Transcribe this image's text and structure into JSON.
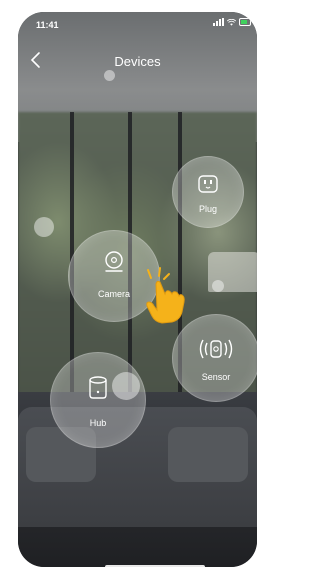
{
  "status_bar": {
    "time": "11:41",
    "battery_color": "#41d15e"
  },
  "nav": {
    "back_icon": "chevron-left-icon",
    "title": "Devices"
  },
  "devices": [
    {
      "label": "Plug",
      "icon": "plug-icon"
    },
    {
      "label": "Camera",
      "icon": "camera-icon"
    },
    {
      "label": "Sensor",
      "icon": "sensor-icon"
    },
    {
      "label": "Hub",
      "icon": "hub-icon"
    }
  ],
  "pointer": {
    "icon": "tap-hand-icon",
    "color": "#f5b21a"
  }
}
